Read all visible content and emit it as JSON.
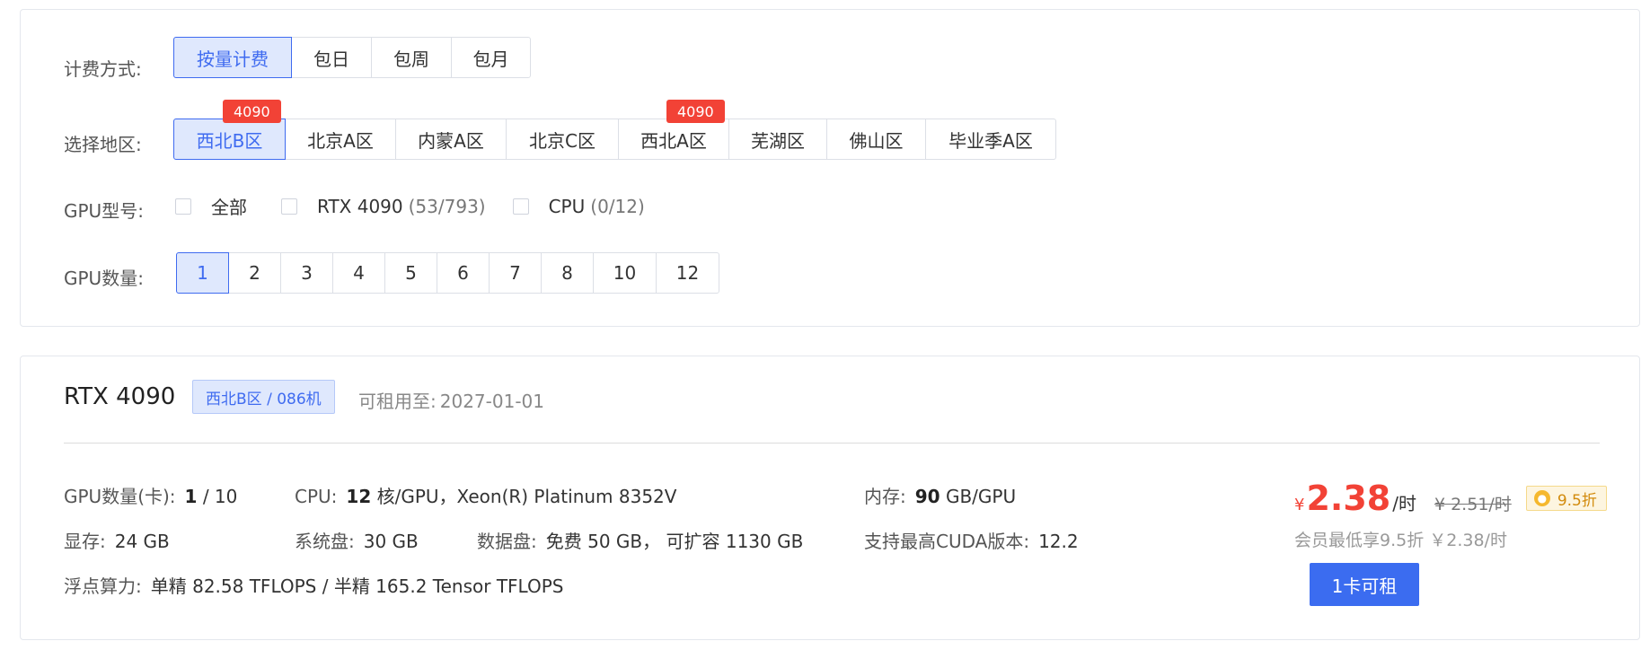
{
  "filters": {
    "billing": {
      "label": "计费方式:",
      "options": [
        "按量计费",
        "包日",
        "包周",
        "包月"
      ],
      "selected": "按量计费"
    },
    "region": {
      "label": "选择地区:",
      "options": [
        "西北B区",
        "北京A区",
        "内蒙A区",
        "北京C区",
        "西北A区",
        "芜湖区",
        "佛山区",
        "毕业季A区"
      ],
      "selected": "西北B区",
      "badges": [
        "4090",
        "4090"
      ]
    },
    "gpu_type": {
      "label": "GPU型号:",
      "options": [
        {
          "label": "全部",
          "count": ""
        },
        {
          "label": "RTX 4090",
          "count": "(53/793)"
        },
        {
          "label": "CPU",
          "count": "(0/12)"
        }
      ]
    },
    "gpu_count": {
      "label": "GPU数量:",
      "options": [
        "1",
        "2",
        "3",
        "4",
        "5",
        "6",
        "7",
        "8",
        "10",
        "12"
      ],
      "selected": "1"
    }
  },
  "card": {
    "title": "RTX 4090",
    "tag": "西北B区 / 086机",
    "available_label": "可租用至:",
    "available_date": "2027-01-01",
    "specs": {
      "gpu_count_label": "GPU数量(卡):",
      "gpu_count_value": "1",
      "gpu_count_total": "/ 10",
      "cpu_label": "CPU:",
      "cpu_cores": "12",
      "cpu_detail": "核/GPU，Xeon(R) Platinum 8352V",
      "mem_label": "内存:",
      "mem_value": "90",
      "mem_unit": "GB/GPU",
      "vram_label": "显存:",
      "vram_value": "24 GB",
      "sysdisk_label": "系统盘:",
      "sysdisk_value": "30 GB",
      "datadisk_label": "数据盘:",
      "datadisk_value": "免费 50 GB， 可扩容 1130 GB",
      "cuda_label": "支持最高CUDA版本:",
      "cuda_value": "12.2",
      "flops_label": "浮点算力:",
      "flops_value": "单精 82.58 TFLOPS / 半精 165.2 Tensor TFLOPS"
    },
    "price": {
      "currency": "¥",
      "value": "2.38",
      "unit": "/时",
      "original": "¥ 2.51/时",
      "discount": "9.5折",
      "member_note": "会员最低享9.5折 ￥2.38/时"
    },
    "rent_button": "1卡可租"
  },
  "colors": {
    "accent": "#3f6bf0",
    "badge": "#f24236",
    "price": "#f24236"
  }
}
